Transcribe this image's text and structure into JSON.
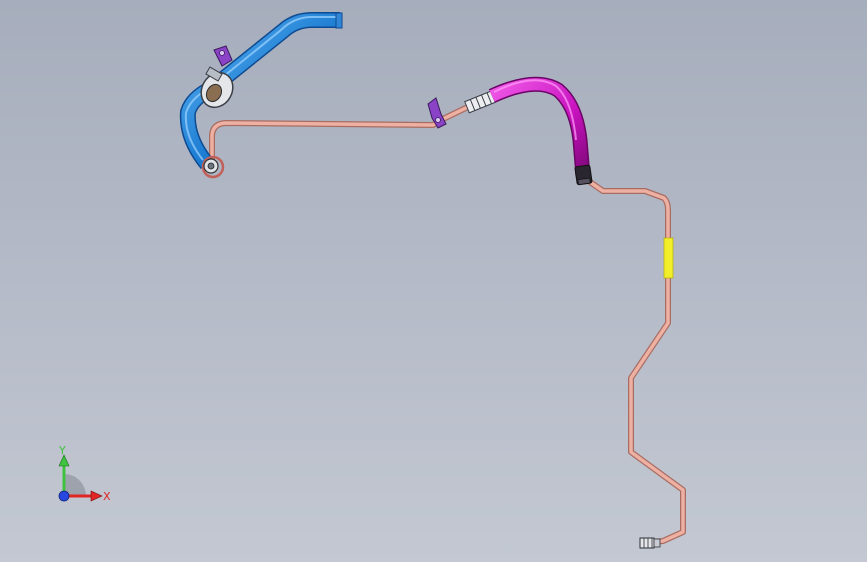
{
  "viewport": {
    "background_top": "#a6adbc",
    "background_bottom": "#c3c8d2"
  },
  "assembly": {
    "tube_color": "#e8a294",
    "tube_edge": "#a86d62",
    "blue_hose_color": "#2f86d6",
    "magenta_hose_color": "#d31ec9",
    "clip_color": "#8a43c6",
    "marker_color": "#f2ef2a"
  },
  "triad": {
    "y_label": "Y",
    "x_label": "X",
    "y_axis_color": "#3fc23f",
    "x_axis_color": "#e02525",
    "z_axis_color": "#2747e0"
  }
}
